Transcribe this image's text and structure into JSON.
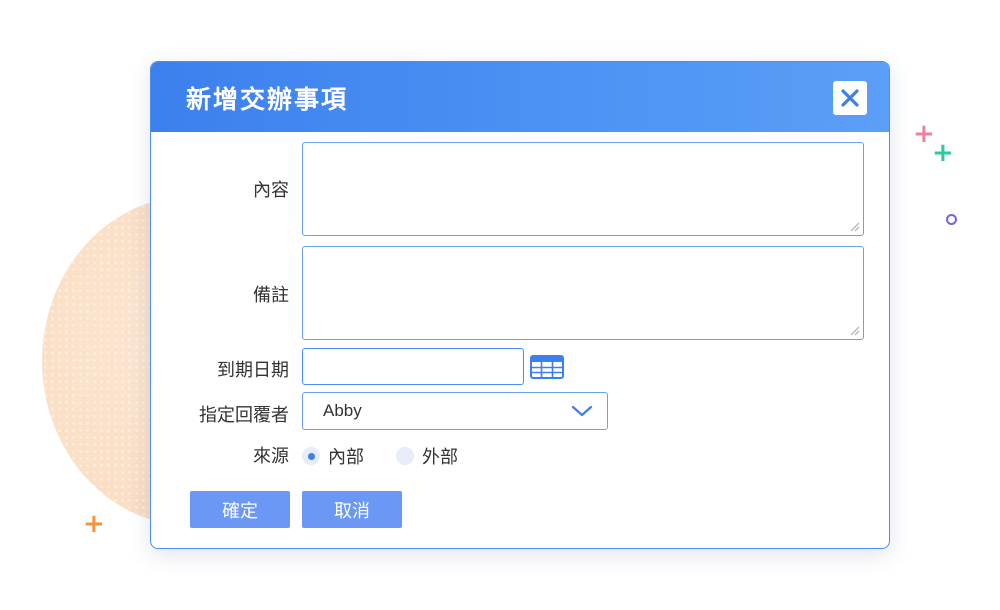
{
  "dialog": {
    "title": "新增交辦事項",
    "close_icon": "close-icon"
  },
  "form": {
    "content_label": "內容",
    "content_value": "",
    "note_label": "備註",
    "note_value": "",
    "due_date_label": "到期日期",
    "due_date_value": "",
    "calendar_icon": "calendar-grid-icon",
    "assignee_label": "指定回覆者",
    "assignee_value": "Abby",
    "source_label": "來源",
    "source_options": [
      {
        "label": "內部",
        "selected": true
      },
      {
        "label": "外部",
        "selected": false
      }
    ]
  },
  "buttons": {
    "confirm_label": "確定",
    "cancel_label": "取消"
  },
  "colors": {
    "header": "#3c80ee",
    "button": "#6b98f5",
    "border": "#4a8ef5"
  }
}
